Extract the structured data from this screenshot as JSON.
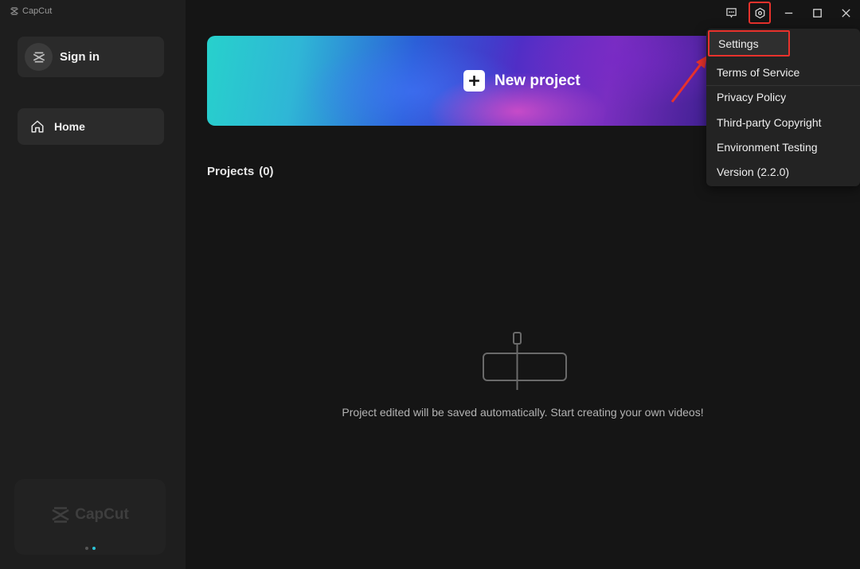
{
  "app": {
    "title": "CapCut"
  },
  "sidebar": {
    "sign_in_label": "Sign in",
    "nav": [
      {
        "label": "Home",
        "icon": "home-icon"
      }
    ],
    "promo_logo_text": "CapCut"
  },
  "header": {
    "icons": [
      "feedback-icon",
      "settings-gear-icon",
      "minimize-icon",
      "maximize-icon",
      "close-icon"
    ]
  },
  "main": {
    "new_project_label": "New project",
    "projects_label": "Projects",
    "projects_count": "(0)",
    "empty_message": "Project edited will be saved automatically. Start creating your own videos!"
  },
  "settings_menu": {
    "items": [
      "Settings",
      "Terms of Service",
      "Privacy Policy",
      "Third-party Copyright",
      "Environment Testing",
      "Version (2.2.0)"
    ]
  },
  "colors": {
    "highlight": "#e8322c",
    "accent": "#2cc3d6",
    "sidebar_bg": "#1e1e1e",
    "main_bg": "#151515"
  }
}
